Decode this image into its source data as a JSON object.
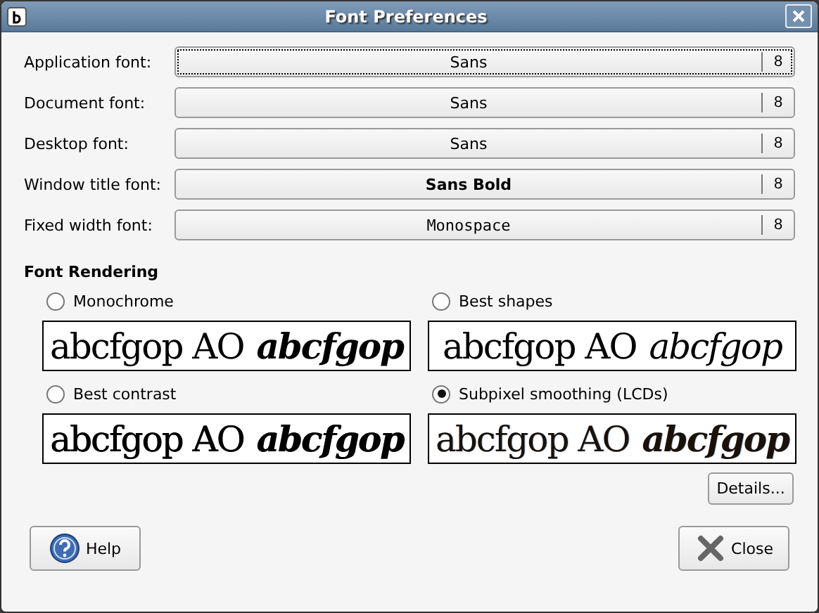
{
  "window": {
    "title": "Font Preferences"
  },
  "fonts": [
    {
      "label": "Application font:",
      "name": "Sans",
      "size": "8",
      "kind": "regular",
      "focused": true
    },
    {
      "label": "Document font:",
      "name": "Sans",
      "size": "8",
      "kind": "regular",
      "focused": false
    },
    {
      "label": "Desktop font:",
      "name": "Sans",
      "size": "8",
      "kind": "regular",
      "focused": false
    },
    {
      "label": "Window title font:",
      "name": "Sans Bold",
      "size": "8",
      "kind": "bold",
      "focused": false
    },
    {
      "label": "Fixed width font:",
      "name": "Monospace",
      "size": "8",
      "kind": "mono",
      "focused": false
    }
  ],
  "rendering": {
    "heading": "Font Rendering",
    "options": [
      {
        "label": "Monochrome",
        "selected": false,
        "sample_plain": "abcfgop AO",
        "sample_italic": "abcfgop",
        "kind": "monochrome"
      },
      {
        "label": "Best shapes",
        "selected": false,
        "sample_plain": "abcfgop AO",
        "sample_italic": "abcfgop",
        "kind": "shapes"
      },
      {
        "label": "Best contrast",
        "selected": false,
        "sample_plain": "abcfgop AO",
        "sample_italic": "abcfgop",
        "kind": "contrast"
      },
      {
        "label": "Subpixel smoothing (LCDs)",
        "selected": true,
        "sample_plain": "abcfgop AO",
        "sample_italic": "abcfgop",
        "kind": "subpixel"
      }
    ]
  },
  "details_button": "Details...",
  "buttons": [
    {
      "label": "Help",
      "kind": "help"
    },
    {
      "label": "Close",
      "kind": "close"
    }
  ]
}
